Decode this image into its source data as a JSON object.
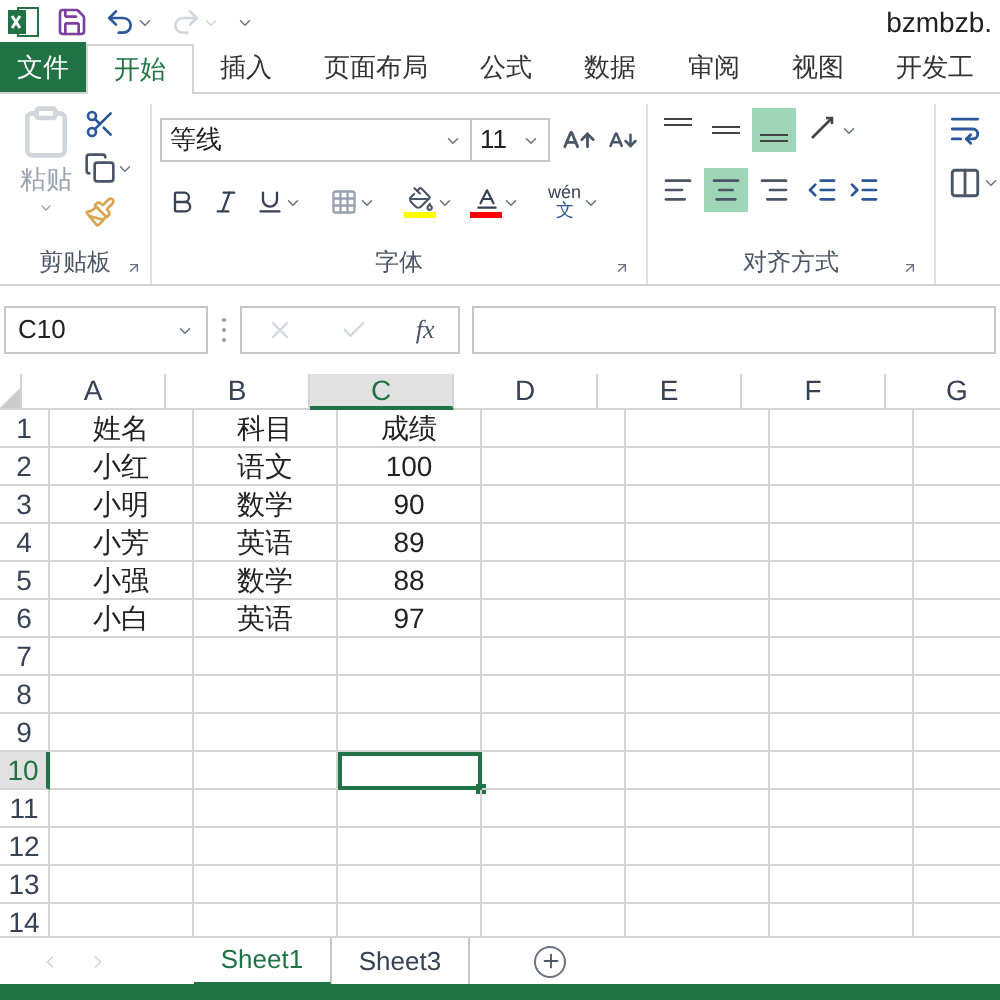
{
  "window": {
    "title": "bzmbzb."
  },
  "tabs": [
    {
      "label": "文件",
      "kind": "file",
      "selected": false
    },
    {
      "label": "开始",
      "kind": "tab",
      "selected": true
    },
    {
      "label": "插入",
      "kind": "tab",
      "selected": false
    },
    {
      "label": "页面布局",
      "kind": "tab",
      "selected": false
    },
    {
      "label": "公式",
      "kind": "tab",
      "selected": false
    },
    {
      "label": "数据",
      "kind": "tab",
      "selected": false
    },
    {
      "label": "审阅",
      "kind": "tab",
      "selected": false
    },
    {
      "label": "视图",
      "kind": "tab",
      "selected": false
    },
    {
      "label": "开发工",
      "kind": "tab",
      "selected": false
    }
  ],
  "ribbon": {
    "clipboard": {
      "paste_label": "粘贴",
      "group_label": "剪贴板"
    },
    "font": {
      "font_name": "等线",
      "font_size": "11",
      "phonetic_top": "wén",
      "phonetic_bottom": "文",
      "group_label": "字体"
    },
    "alignment": {
      "group_label": "对齐方式",
      "vertical": [
        {
          "kind": "top",
          "selected": false
        },
        {
          "kind": "middle",
          "selected": false
        },
        {
          "kind": "bottom",
          "selected": true
        }
      ],
      "horizontal": [
        {
          "kind": "left",
          "selected": false
        },
        {
          "kind": "center",
          "selected": true
        },
        {
          "kind": "right",
          "selected": false
        }
      ]
    }
  },
  "formula_bar": {
    "name_box": "C10",
    "function_label": "fx"
  },
  "grid": {
    "columns": [
      {
        "label": "A",
        "selected": false
      },
      {
        "label": "B",
        "selected": false
      },
      {
        "label": "C",
        "selected": true
      },
      {
        "label": "D",
        "selected": false
      },
      {
        "label": "E",
        "selected": false
      },
      {
        "label": "F",
        "selected": false
      },
      {
        "label": "G",
        "selected": false
      }
    ],
    "rows": [
      {
        "label": "1",
        "selected": false,
        "cells": [
          "姓名",
          "科目",
          "成绩"
        ]
      },
      {
        "label": "2",
        "selected": false,
        "cells": [
          "小红",
          "语文",
          "100"
        ]
      },
      {
        "label": "3",
        "selected": false,
        "cells": [
          "小明",
          "数学",
          "90"
        ]
      },
      {
        "label": "4",
        "selected": false,
        "cells": [
          "小芳",
          "英语",
          "89"
        ]
      },
      {
        "label": "5",
        "selected": false,
        "cells": [
          "小强",
          "数学",
          "88"
        ]
      },
      {
        "label": "6",
        "selected": false,
        "cells": [
          "小白",
          "英语",
          "97"
        ]
      },
      {
        "label": "7",
        "selected": false,
        "cells": []
      },
      {
        "label": "8",
        "selected": false,
        "cells": []
      },
      {
        "label": "9",
        "selected": false,
        "cells": []
      },
      {
        "label": "10",
        "selected": true,
        "cells": []
      },
      {
        "label": "11",
        "selected": false,
        "cells": []
      },
      {
        "label": "12",
        "selected": false,
        "cells": []
      },
      {
        "label": "13",
        "selected": false,
        "cells": []
      },
      {
        "label": "14",
        "selected": false,
        "cells": []
      }
    ]
  },
  "sheets": [
    {
      "label": "Sheet1",
      "selected": true
    },
    {
      "label": "Sheet3",
      "selected": false
    }
  ]
}
